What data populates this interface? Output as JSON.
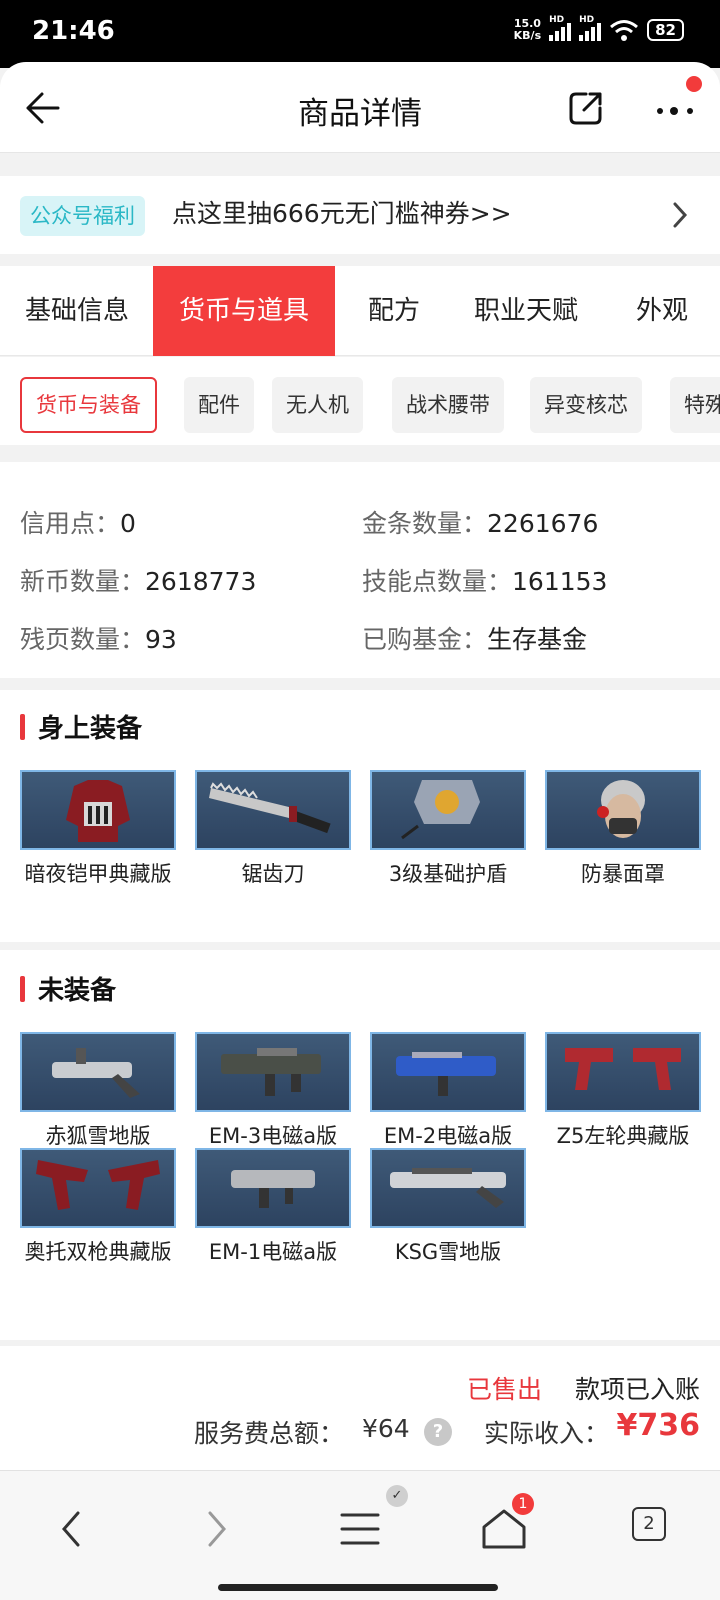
{
  "status_bar": {
    "time": "21:46",
    "net_speed_value": "15.0",
    "net_speed_unit": "KB/s",
    "signal1_label": "HD",
    "signal2_label": "HD",
    "battery": "82"
  },
  "header": {
    "title": "商品详情",
    "icons": [
      "back-arrow-icon",
      "share-icon",
      "more-icon"
    ]
  },
  "promo": {
    "tag": "公众号福利",
    "text": "点这里抽666元无门槛神券>>"
  },
  "tabs": [
    {
      "label": "基础信息",
      "active": false
    },
    {
      "label": "货币与道具",
      "active": true
    },
    {
      "label": "配方",
      "active": false
    },
    {
      "label": "职业天赋",
      "active": false
    },
    {
      "label": "外观",
      "active": false
    }
  ],
  "chips": [
    {
      "label": "货币与装备",
      "active": true
    },
    {
      "label": "配件",
      "active": false
    },
    {
      "label": "无人机",
      "active": false
    },
    {
      "label": "战术腰带",
      "active": false
    },
    {
      "label": "异变核芯",
      "active": false
    },
    {
      "label": "特殊",
      "active": false
    }
  ],
  "info": [
    {
      "label": "信用点：",
      "value": "0"
    },
    {
      "label": "金条数量：",
      "value": "2261676"
    },
    {
      "label": "新币数量：",
      "value": "2618773"
    },
    {
      "label": "技能点数量：",
      "value": "161153"
    },
    {
      "label": "残页数量：",
      "value": "93"
    },
    {
      "label": "已购基金：",
      "value": "生存基金"
    }
  ],
  "equipped": {
    "title": "身上装备",
    "items": [
      "暗夜铠甲典藏版",
      "锯齿刀",
      "3级基础护盾",
      "防暴面罩"
    ]
  },
  "unequipped": {
    "title": "未装备",
    "items": [
      "赤狐雪地版",
      "EM-3电磁a版",
      "EM-2电磁a版",
      "Z5左轮典藏版",
      "奥托双枪典藏版",
      "EM-1电磁a版",
      "KSG雪地版"
    ]
  },
  "footer": {
    "sold": "已售出",
    "paid": "款项已入账",
    "fee_label": "服务费总额：",
    "fee": "¥64",
    "help": "?",
    "income_label": "实际收入：",
    "income": "¥736"
  },
  "bottom_bar": {
    "home_badge": "1",
    "tab_count": "2"
  },
  "colors": {
    "accent_red": "#f33d3d",
    "promo_tag_bg": "#d8f4f7",
    "promo_tag_text": "#2bb8c6"
  }
}
